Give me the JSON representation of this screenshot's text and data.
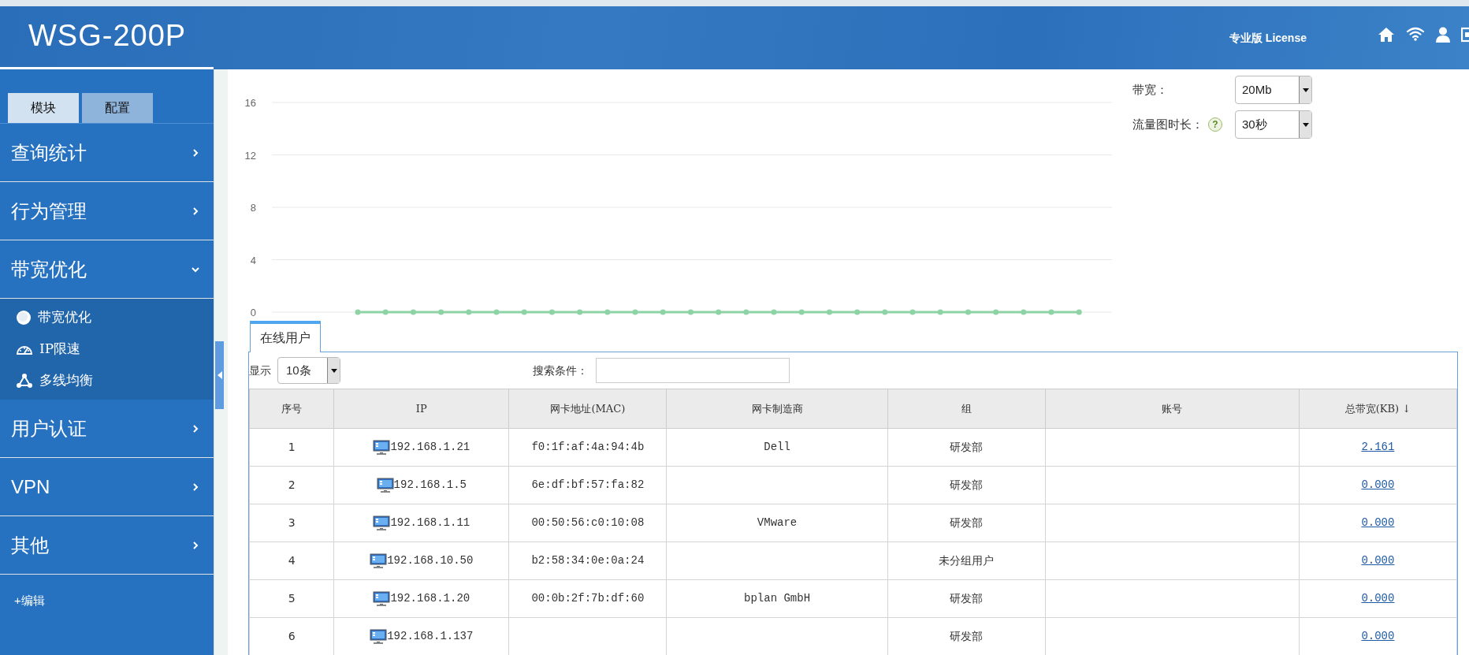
{
  "header": {
    "title": "WSG-200P",
    "license": "专业版 License"
  },
  "sidebar": {
    "tabs": [
      {
        "label": "模块",
        "selected": true
      },
      {
        "label": "配置",
        "selected": false
      }
    ],
    "menu": [
      {
        "label": "查询统计",
        "expanded": false
      },
      {
        "label": "行为管理",
        "expanded": false
      },
      {
        "label": "带宽优化",
        "expanded": true,
        "children": [
          {
            "label": "带宽优化"
          },
          {
            "label": "IP限速"
          },
          {
            "label": "多线均衡"
          }
        ]
      },
      {
        "label": "用户认证",
        "expanded": false
      },
      {
        "label": "VPN",
        "expanded": false
      },
      {
        "label": "其他",
        "expanded": false
      }
    ],
    "edit_link": "+编辑"
  },
  "traffic_chart": {
    "chart_data": {
      "type": "line",
      "grid": true,
      "ylim": [
        0,
        16
      ],
      "yticks": [
        0,
        4,
        8,
        12,
        16
      ],
      "series": [
        {
          "color": "#8ed3a6",
          "marker": "circle",
          "values": [
            0,
            0,
            0,
            0,
            0,
            0,
            0,
            0,
            0,
            0,
            0,
            0,
            0,
            0,
            0,
            0,
            0,
            0,
            0,
            0,
            0,
            0,
            0,
            0,
            0,
            0,
            0
          ]
        }
      ]
    }
  },
  "settings": [
    {
      "label": "带宽：",
      "value": "20Mb"
    },
    {
      "label": "流量图时长：",
      "help": "?",
      "value": "30秒"
    }
  ],
  "panel": {
    "tab": "在线用户",
    "show_label": "显示",
    "page_size": "10条",
    "search_label": "搜索条件：",
    "table": {
      "columns": [
        {
          "label": "序号"
        },
        {
          "label": "IP"
        },
        {
          "label": "网卡地址(MAC)"
        },
        {
          "label": "网卡制造商"
        },
        {
          "label": "组"
        },
        {
          "label": "账号"
        },
        {
          "label": "总带宽(KB)",
          "sort": "↓"
        }
      ],
      "rows": [
        {
          "index": "1",
          "ip": "192.168.1.21",
          "mac": "f0:1f:af:4a:94:4b",
          "vendor": "Dell",
          "group": "研发部",
          "total": "2.161"
        },
        {
          "index": "2",
          "ip": "192.168.1.5",
          "mac": "6e:df:bf:57:fa:82",
          "group": "研发部",
          "total": "0.000"
        },
        {
          "index": "3",
          "ip": "192.168.1.11",
          "mac": "00:50:56:c0:10:08",
          "vendor": "VMware",
          "group": "研发部",
          "total": "0.000"
        },
        {
          "index": "4",
          "ip": "192.168.10.50",
          "mac": "b2:58:34:0e:0a:24",
          "group": "未分组用户",
          "total": "0.000"
        },
        {
          "index": "5",
          "ip": "192.168.1.20",
          "mac": "00:0b:2f:7b:df:60",
          "vendor": "bplan GmbH",
          "group": "研发部",
          "total": "0.000"
        },
        {
          "index": "6",
          "ip": "192.168.1.137",
          "group": "研发部",
          "total": "0.000"
        }
      ]
    }
  }
}
